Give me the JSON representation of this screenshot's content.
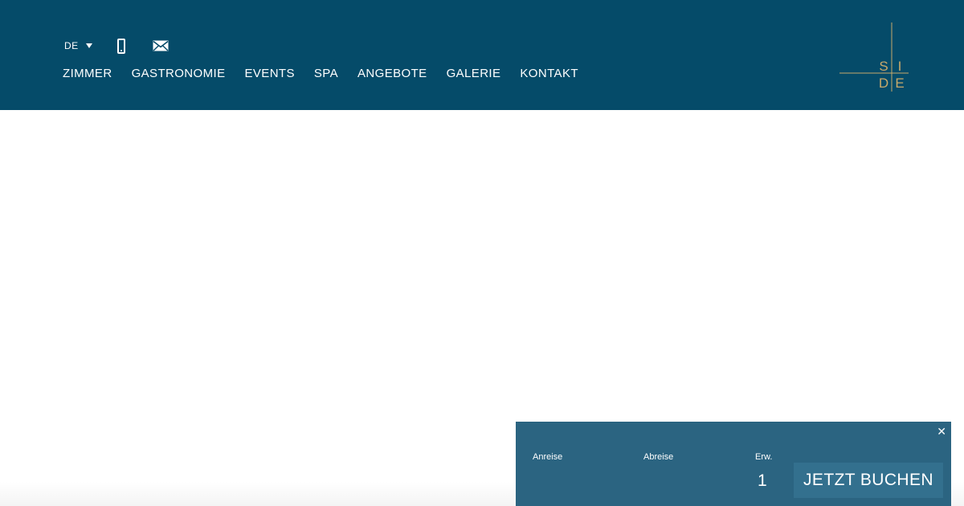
{
  "colors": {
    "header_bg": "#054b69",
    "booking_bg": "#2b6481",
    "button_bg": "#33708e",
    "logo_gold": "#c8a96a"
  },
  "header": {
    "language": {
      "current": "DE",
      "icon": "chevron-down-icon"
    },
    "utility_icons": [
      "phone-icon",
      "mail-icon"
    ],
    "nav": [
      "ZIMMER",
      "GASTRONOMIE",
      "EVENTS",
      "SPA",
      "ANGEBOTE",
      "GALERIE",
      "KONTAKT"
    ],
    "logo": {
      "letters": [
        "S",
        "I",
        "D",
        "E"
      ]
    }
  },
  "booking": {
    "close_icon": "close-icon",
    "arrival_label": "Anreise",
    "departure_label": "Abreise",
    "adults_label": "Erw.",
    "adults_value": "1",
    "book_button": "JETZT BUCHEN"
  }
}
